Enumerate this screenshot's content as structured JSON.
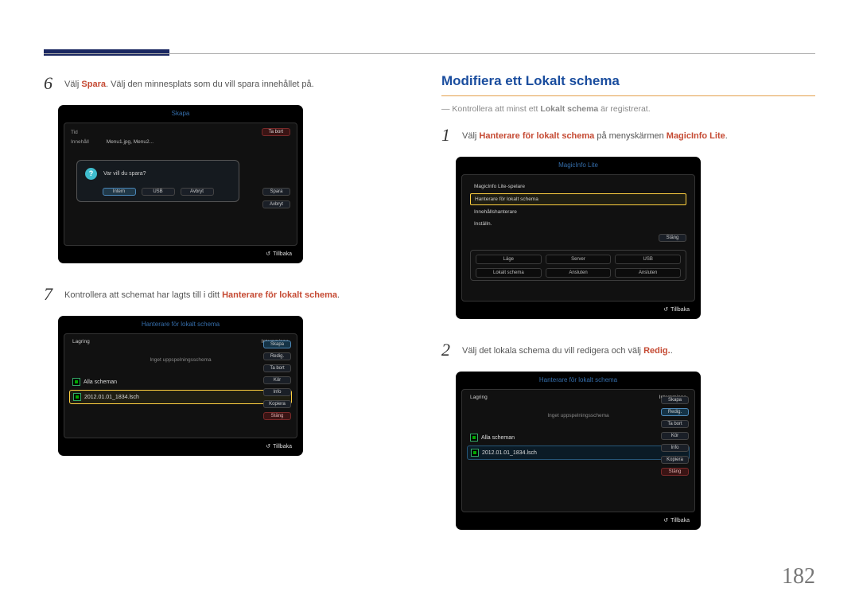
{
  "page_number": "182",
  "left": {
    "step6": {
      "num": "6",
      "pre": "Välj ",
      "bold": "Spara",
      "post": ". Välj den minnesplats som du vill spara innehållet på."
    },
    "step7": {
      "num": "7",
      "pre": "Kontrollera att schemat har lagts till i ditt ",
      "bold": "Hanterare för lokalt schema",
      "post": "."
    }
  },
  "right": {
    "section_title": "Modifiera ett Lokalt schema",
    "note_pre": "Kontrollera att minst ett ",
    "note_bold": "Lokalt schema",
    "note_post": " är registrerat.",
    "step1": {
      "num": "1",
      "pre": "Välj ",
      "bold1": "Hanterare för lokalt schema",
      "mid": " på menyskärmen ",
      "bold2": "MagicInfo Lite",
      "post": "."
    },
    "step2": {
      "num": "2",
      "pre": "Välj det lokala schema du vill redigera och välj ",
      "bold": "Redig.",
      "post": "."
    }
  },
  "panel_skapa": {
    "title": "Skapa",
    "row_tid": "Tid",
    "row_innehall": "Innehåll",
    "content_value": "Menu1.jpg, Menu2...",
    "btn_tabort": "Ta bort",
    "btn_spara": "Spara",
    "btn_avbryt": "Avbryt",
    "popup_text": "Var vill du spara?",
    "pop_intern": "Intern",
    "pop_usb": "USB",
    "pop_avbryt": "Avbryt",
    "foot": "Tillbaka"
  },
  "panel_hant1": {
    "title": "Hanterare för lokalt schema",
    "lagring": "Lagring",
    "internminne": "Internminne",
    "nosched": "Inget uppspelningsschema",
    "all": "Alla scheman",
    "item": "2012.01.01_1834.lsch",
    "btns": [
      "Skapa",
      "Redig.",
      "Ta bort",
      "Kör",
      "Info",
      "Kopiera",
      "Stäng"
    ],
    "foot": "Tillbaka"
  },
  "panel_magic": {
    "title": "MagicInfo Lite",
    "items": [
      "MagicInfo Lite-spelare",
      "Hanterare för lokalt schema",
      "Innehållshanterare",
      "Inställn."
    ],
    "grid_head": [
      "Läge",
      "Server",
      "USB"
    ],
    "grid_vals": [
      "Lokalt schema",
      "Ansluten",
      "Ansluten"
    ],
    "stang": "Stäng",
    "foot": "Tillbaka"
  },
  "panel_hant2": {
    "title": "Hanterare för lokalt schema",
    "lagring": "Lagring",
    "internminne": "Internminne",
    "nosched": "Inget uppspelningsschema",
    "all": "Alla scheman",
    "item": "2012.01.01_1834.lsch",
    "btns": [
      "Skapa",
      "Redig.",
      "Ta bort",
      "Kör",
      "Info",
      "Kopiera",
      "Stäng"
    ],
    "foot": "Tillbaka"
  }
}
